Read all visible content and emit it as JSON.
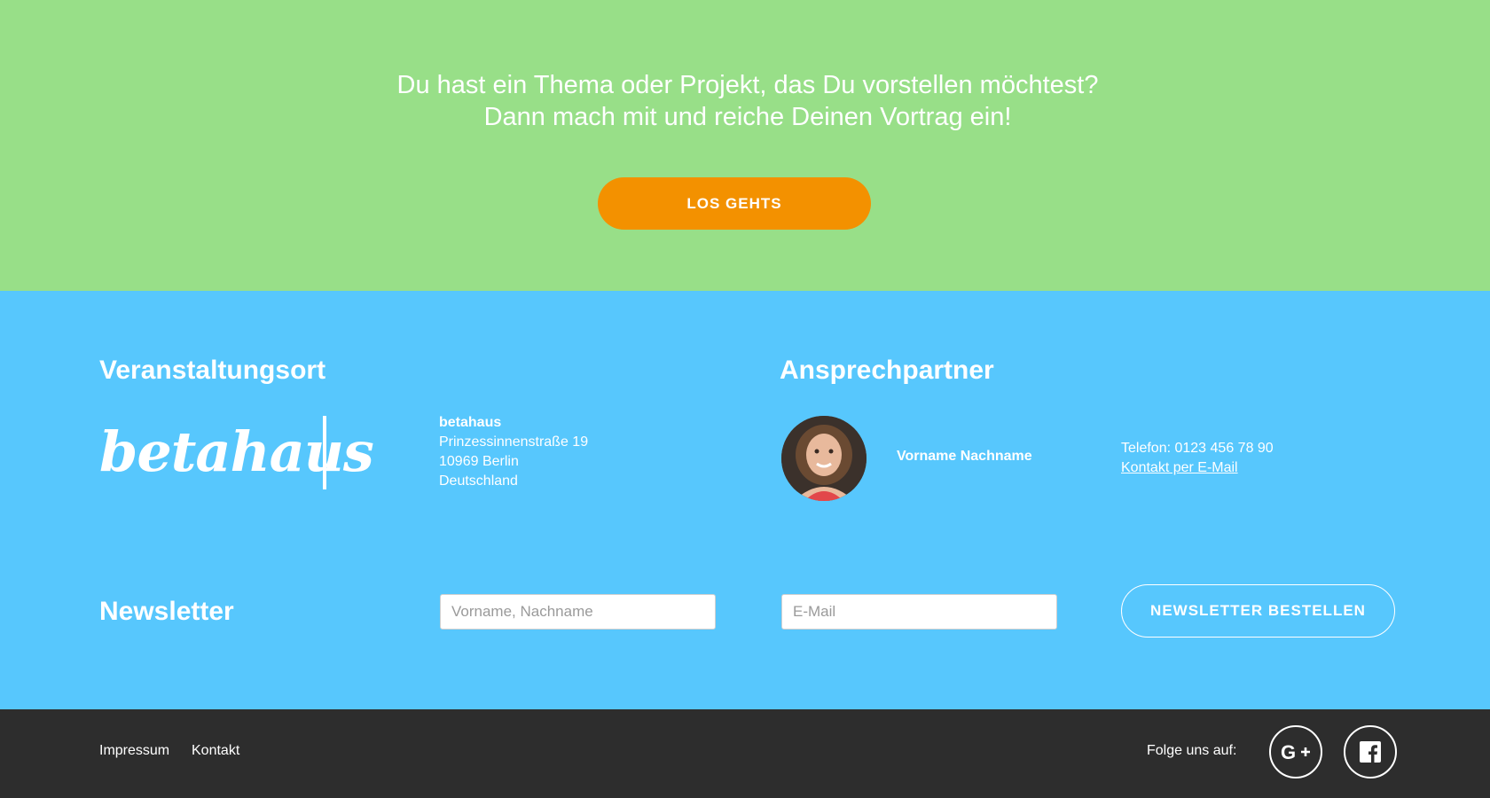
{
  "cta": {
    "line1": "Du hast ein Thema oder Projekt, das Du vorstellen möchtest?",
    "line2": "Dann mach mit und reiche Deinen Vortrag ein!",
    "button_label": "LOS GEHTS",
    "background_color": "#98df88",
    "button_color": "#f39100"
  },
  "venue": {
    "heading": "Veranstaltungsort",
    "logo_text": "betahaus",
    "address": {
      "name": "betahaus",
      "street": "Prinzessinnenstraße 19",
      "city": "10969 Berlin",
      "country": "Deutschland"
    }
  },
  "contact": {
    "heading": "Ansprechpartner",
    "name": "Vorname Nachname",
    "phone": "Telefon: 0123 456 78 90",
    "email_link": "Kontakt per E-Mail"
  },
  "newsletter": {
    "heading": "Newsletter",
    "name_placeholder": "Vorname, Nachname",
    "email_placeholder": "E-Mail",
    "button_label": "NEWSLETTER BESTELLEN"
  },
  "footer": {
    "links": [
      "Impressum",
      "Kontakt"
    ],
    "follow_label": "Folge uns auf:",
    "social_icons": [
      "google-plus-icon",
      "facebook-icon"
    ],
    "background_color": "#2d2d2d"
  },
  "info_background_color": "#57c7fd"
}
